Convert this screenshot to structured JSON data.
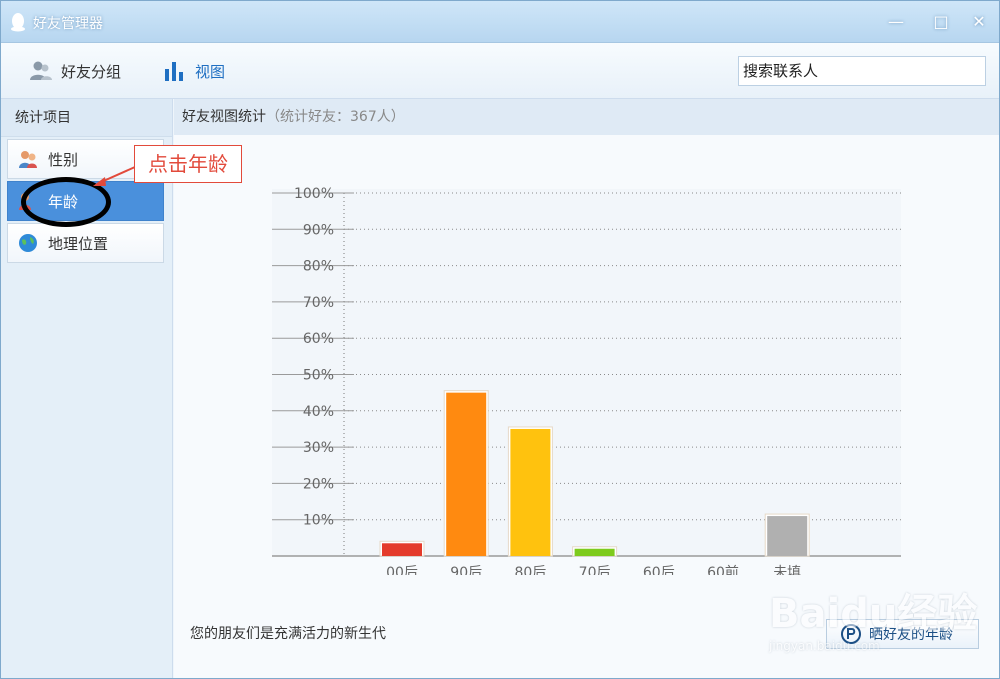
{
  "window": {
    "title": "好友管理器"
  },
  "toolbar": {
    "groups_label": "好友分组",
    "view_label": "视图",
    "search_placeholder": "搜索联系人"
  },
  "sidebar": {
    "heading": "统计项目",
    "items": [
      {
        "label": "性别",
        "icon": "gender-icon"
      },
      {
        "label": "年龄",
        "icon": "age-icon"
      },
      {
        "label": "地理位置",
        "icon": "globe-icon"
      }
    ]
  },
  "main": {
    "heading": "好友视图统计",
    "subheading": "（统计好友：367人）",
    "footer_text": "您的朋友们是充满活力的新生代",
    "share_button": "晒好友的年龄"
  },
  "annotation": {
    "text": "点击年龄"
  },
  "watermark": {
    "text": "Baidu经验",
    "url": "jingyan.baidu.com"
  },
  "chart_data": {
    "type": "bar",
    "categories": [
      "00后",
      "90后",
      "80后",
      "70后",
      "60后",
      "60前",
      "未填"
    ],
    "values": [
      3.5,
      45,
      35,
      2,
      0,
      0,
      11
    ],
    "colors": [
      "#e43b2b",
      "#ff8a10",
      "#ffc20e",
      "#7ecb1d",
      "#999999",
      "#999999",
      "#b0b0b0"
    ],
    "ylim": [
      0,
      100
    ],
    "yticks": [
      "10%",
      "20%",
      "30%",
      "40%",
      "50%",
      "60%",
      "70%",
      "80%",
      "90%",
      "100%"
    ],
    "grid": true
  }
}
